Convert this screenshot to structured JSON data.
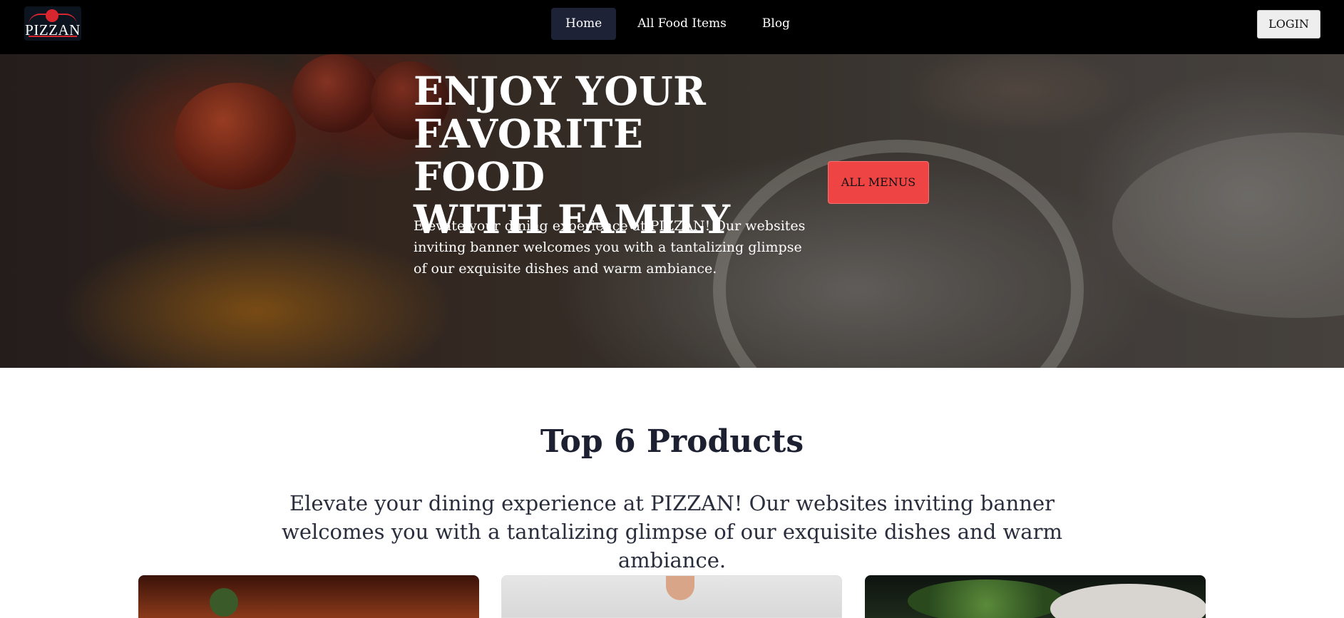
{
  "navbar": {
    "logo_text": "PIZZAN",
    "links": [
      "Home",
      "All Food Items",
      "Blog"
    ],
    "active_link": "Home",
    "login_label": "LOGIN"
  },
  "hero": {
    "title_lines": [
      "ENJOY YOUR",
      "FAVORITE FOOD",
      "WITH FAMILY"
    ],
    "description": "Elevate your dining experience at PIZZAN! Our websites inviting banner welcomes you with a tantalizing glimpse of our exquisite dishes and warm ambiance.",
    "button_label": "ALL MENUS"
  },
  "products": {
    "title": "Top 6 Products",
    "description": "Elevate your dining experience at PIZZAN! Our websites inviting banner welcomes you with a tantalizing glimpse of our exquisite dishes and warm ambiance."
  },
  "colors": {
    "navbar_bg": "#000000",
    "active_link_bg": "#1d2236",
    "accent_button": "#ef4444",
    "heading_text": "#1c2030"
  }
}
